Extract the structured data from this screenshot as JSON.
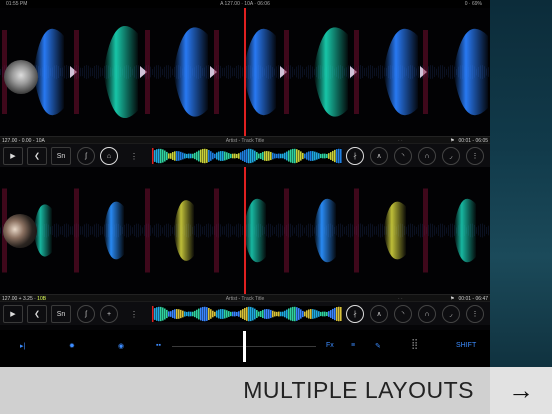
{
  "status": {
    "time": "01:55 PM",
    "center": "A 127.00 · 10A · 06:06",
    "battery": "0 · 69%"
  },
  "deckA": {
    "info_left": "127.00 - 0.00 - 10A",
    "title": "Artist - Track Title",
    "pages": "· ·",
    "time": "00:01 - 06:05",
    "flag": "⚑",
    "artwork": "cloud-artwork",
    "play_icon": "▶",
    "cue_icon": "❮",
    "sync_label": "Sn",
    "menu": "⋮",
    "loop_icons": [
      "ʃ",
      "⌂"
    ],
    "fx_icons": [
      "∤",
      "∧",
      "◝",
      "∩",
      "◞",
      "⋮"
    ]
  },
  "deckB": {
    "info_left": "127.00 + 3.25 · ",
    "info_hl": "10B",
    "title": "Artist - Track Title",
    "pages": "· ·",
    "time": "00:01 - 06:47",
    "flag": "⚑",
    "artwork": "faces-artwork",
    "play_icon": "▶",
    "cue_icon": "❮",
    "sync_label": "Sn",
    "menu": "⋮",
    "loop_icons": [
      "ʃ",
      "+"
    ],
    "fx_icons": [
      "∤",
      "∧",
      "◝",
      "∩",
      "◞",
      "⋮"
    ]
  },
  "mixer": {
    "items": [
      "▸|",
      "✹",
      "◉",
      "▪▪",
      "Fx",
      "≡",
      "✎",
      "⣿",
      "SHIFT"
    ],
    "accent": "#3c8cff"
  },
  "banner": {
    "text": "MULTIPLE LAYOUTS",
    "arrow": "→"
  },
  "colors": {
    "playhead": "#e02020",
    "accent": "#3c8cff"
  }
}
